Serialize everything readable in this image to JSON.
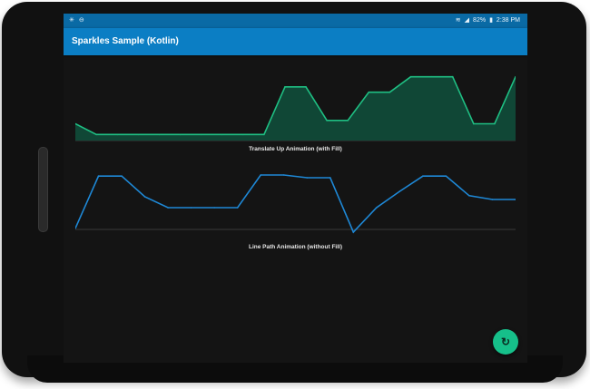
{
  "status_bar": {
    "left_icons": [
      "notification-icon",
      "sync-icon"
    ],
    "battery": "82%",
    "time": "2:38 PM"
  },
  "app_bar": {
    "title": "Sparkles Sample (Kotlin)"
  },
  "charts": [
    {
      "caption": "Translate Up Animation (with Fill)"
    },
    {
      "caption": "Line Path Animation (without Fill)"
    }
  ],
  "fab": {
    "icon": "refresh-icon"
  },
  "colors": {
    "status_bar": "#0a6aa5",
    "app_bar": "#0b7ec4",
    "screen_bg": "#141414",
    "fill_line": "#1fbf83",
    "fill_area": "#0f4d3a",
    "line_path": "#1e88d6",
    "fab": "#16c08a"
  },
  "chart_data": [
    {
      "type": "area",
      "title": "Translate Up Animation (with Fill)",
      "x": [
        0,
        1,
        2,
        3,
        4,
        5,
        6,
        7,
        8,
        9,
        10,
        11,
        12,
        13,
        14,
        15,
        16,
        17,
        18,
        19
      ],
      "values": [
        0.25,
        0.09,
        0.09,
        0.09,
        0.09,
        0.09,
        0.09,
        0.09,
        0.09,
        0.09,
        0.8,
        0.8,
        0.3,
        0.3,
        0.72,
        0.72,
        0.95,
        0.95,
        0.95,
        0.25,
        0.25,
        0.95
      ],
      "grid": false
    },
    {
      "type": "line",
      "title": "Line Path Animation (without Fill)",
      "values": [
        0.02,
        0.98,
        0.98,
        0.6,
        0.4,
        0.4,
        0.4,
        0.4,
        1.0,
        1.0,
        0.95,
        0.95,
        -0.05,
        0.4,
        0.7,
        0.98,
        0.98,
        0.62,
        0.55,
        0.55
      ],
      "grid": false
    }
  ]
}
